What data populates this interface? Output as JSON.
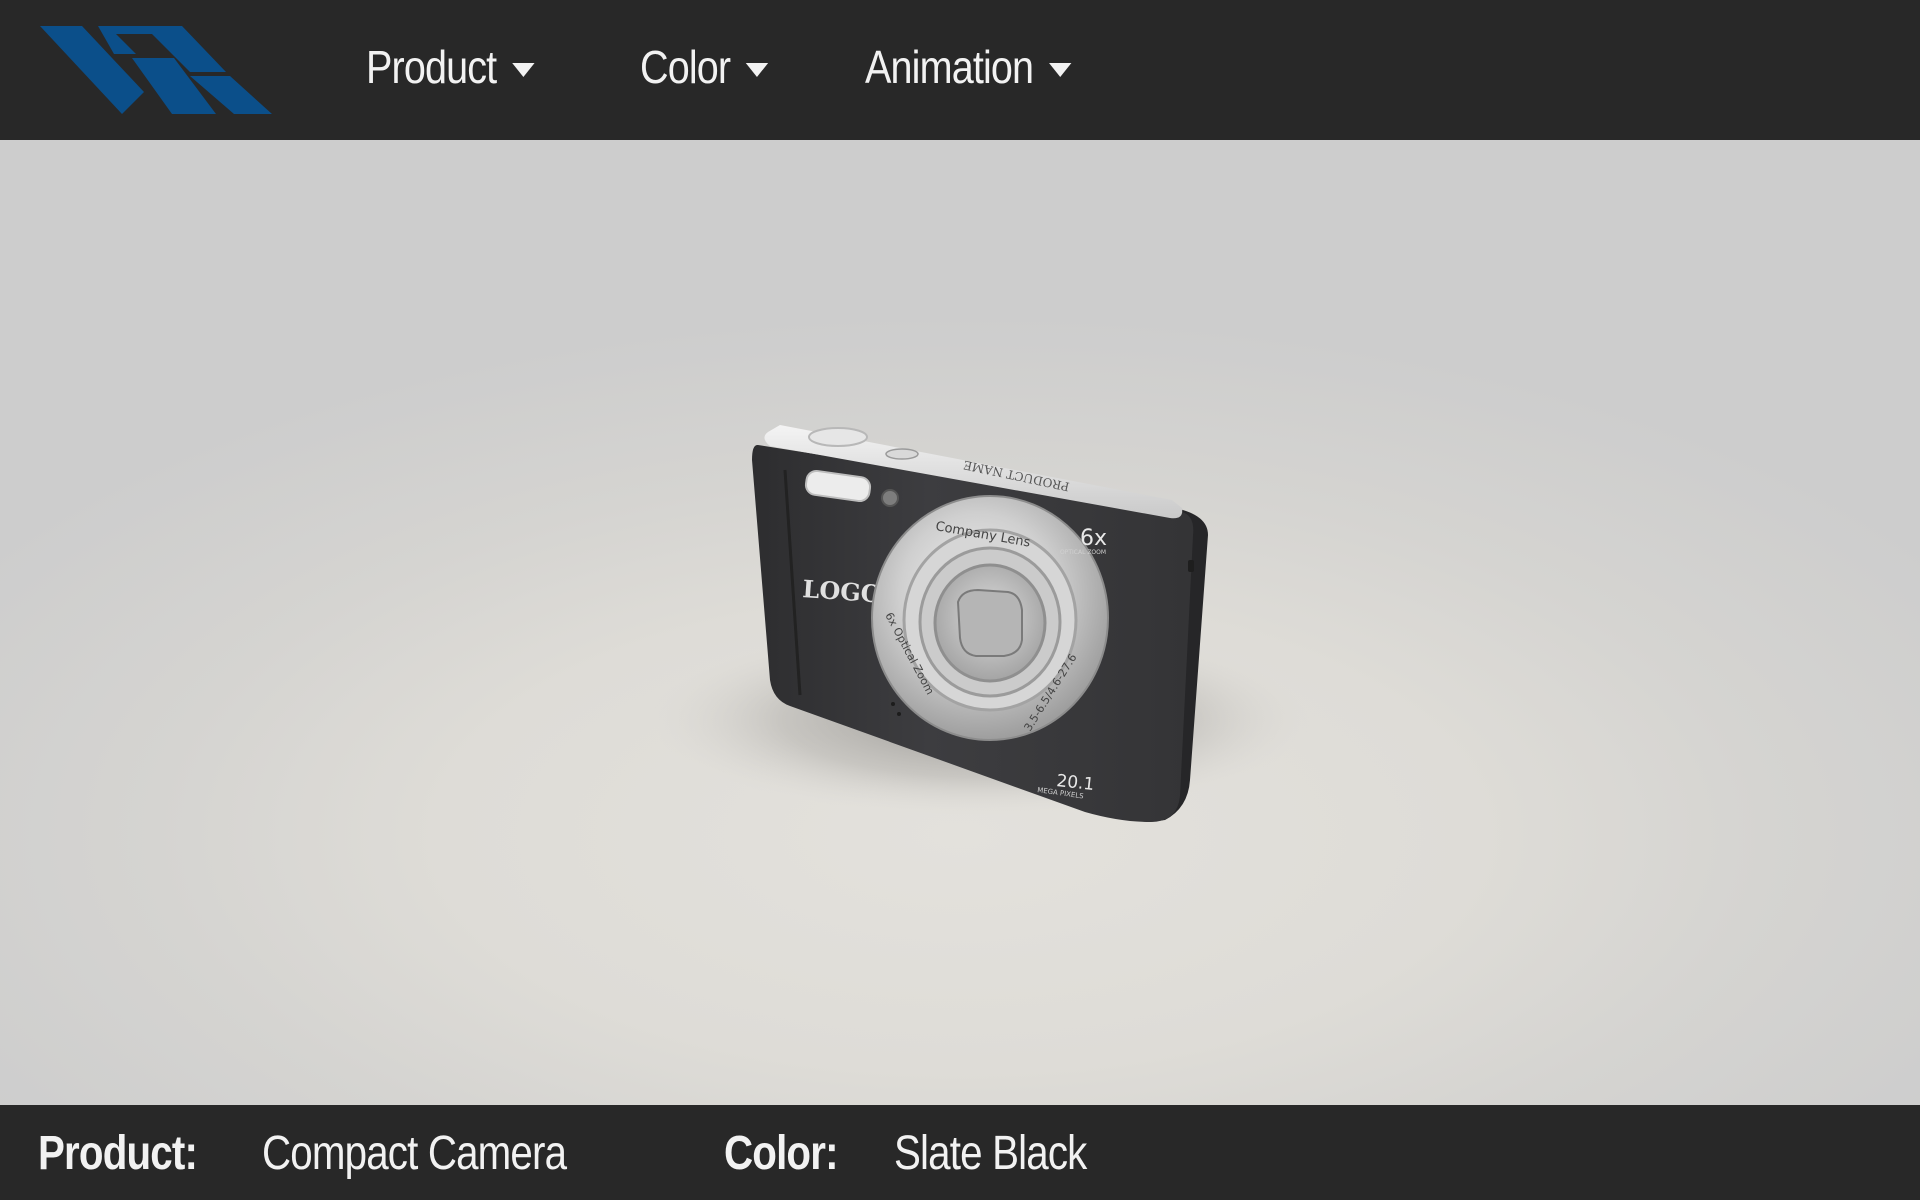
{
  "app": {
    "brand_color": "#0b4f8a",
    "bar_color": "#282828"
  },
  "menu": {
    "items": [
      {
        "label": "Product",
        "icon": "caret-down-icon"
      },
      {
        "label": "Color",
        "icon": "caret-down-icon"
      },
      {
        "label": "Animation",
        "icon": "caret-down-icon"
      }
    ]
  },
  "status": {
    "product_label": "Product:",
    "product_value": "Compact Camera",
    "color_label": "Color:",
    "color_value": "Slate Black"
  },
  "camera": {
    "body_color": "#3a3a3c",
    "front_logo": "LOGO",
    "lens_brand": "Company Lens",
    "zoom_badge": "6x",
    "zoom_badge_sub": "OPTICAL ZOOM",
    "lens_ring_left": "6x Optical Zoom",
    "lens_ring_right": "3.5-6.5/4.6-27.6",
    "megapixels": "20.1",
    "megapixels_sub": "MEGA PIXELS",
    "top_label": "PRODUCT NAME"
  }
}
